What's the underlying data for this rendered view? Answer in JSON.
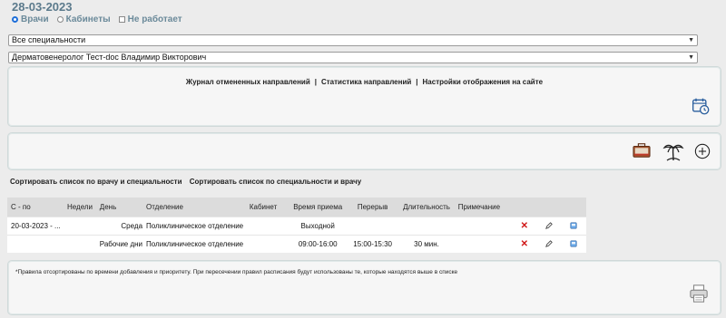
{
  "header": {
    "date": "28-03-2023",
    "modes": [
      {
        "label": "Врачи",
        "type": "radio",
        "checked": true
      },
      {
        "label": "Кабинеты",
        "type": "radio",
        "checked": false
      },
      {
        "label": "Не работает",
        "type": "checkbox",
        "checked": false
      }
    ]
  },
  "filters": {
    "specialty_selected": "Все специальности",
    "doctor_selected": "Дерматовенеролог Тест-doc Владимир Викторович"
  },
  "top_panel": {
    "links": [
      "Журнал отмененных направлений",
      "Статистика направлений",
      "Настройки отображения на сайте"
    ],
    "separator": "|"
  },
  "toolbar_icons": [
    "calendar-clock-icon",
    "briefcase-icon",
    "palm-tree-icon",
    "add-icon"
  ],
  "sort": {
    "by_doctor": "Сортировать список по врачу и специальности",
    "by_specialty": "Сортировать список по специальности и врачу"
  },
  "table": {
    "headers": {
      "from": "С - по",
      "weeks": "Недели",
      "day": "День",
      "dept": "Отделение",
      "cabinet": "Кабинет",
      "time": "Время приема",
      "break": "Перерыв",
      "duration": "Длительность",
      "note": "Примечание"
    },
    "rows": [
      {
        "from": "20-03-2023 - ...",
        "weeks": "",
        "day": "Среда",
        "dept": "Поликлиническое отделение",
        "cabinet": "",
        "time": "Выходной",
        "break": "",
        "duration": "",
        "note": ""
      },
      {
        "from": "",
        "weeks": "",
        "day": "Рабочие дни",
        "dept": "Поликлиническое отделение",
        "cabinet": "",
        "time": "09:00-16:00",
        "break": "15:00-15:30",
        "duration": "30 мин.",
        "note": ""
      }
    ]
  },
  "footer": {
    "note": "*Правила отсортированы по времени добавления и приоритету. При пересечении правил расписания будут использованы те, которые находятся выше в списке"
  },
  "colors": {
    "title": "#5b7a8c",
    "delete": "#d01818",
    "accent_blue": "#2b5f9e"
  }
}
